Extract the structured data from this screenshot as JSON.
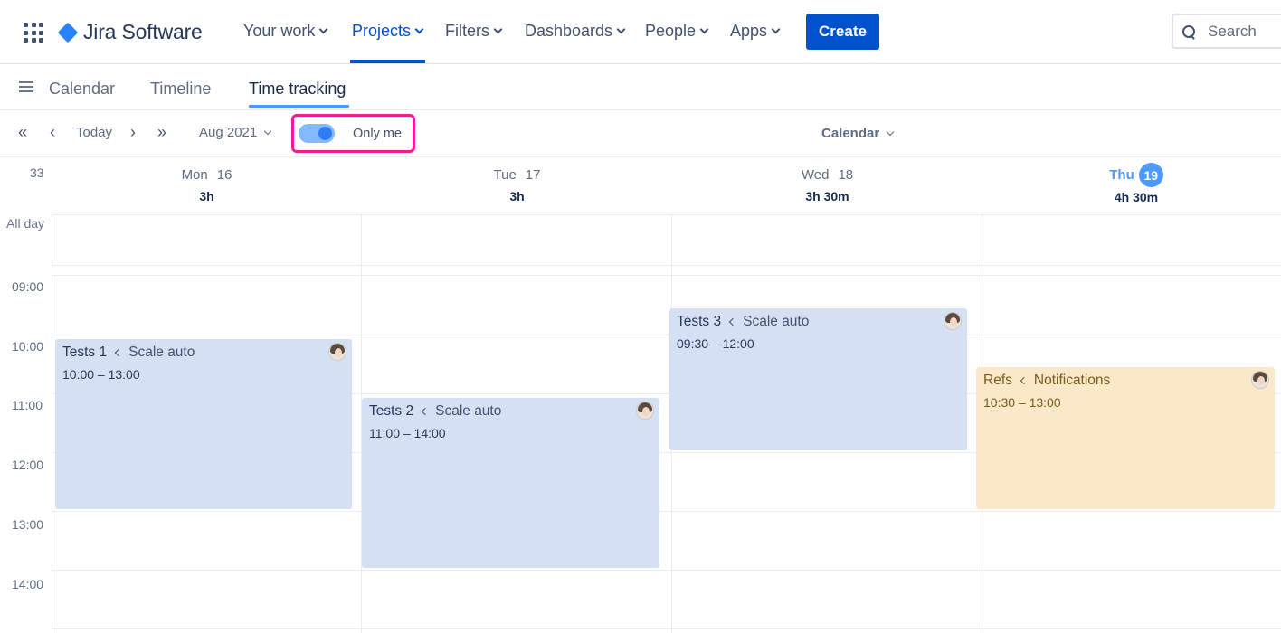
{
  "nav": {
    "logo_text": "Jira Software",
    "items": [
      {
        "label": "Your work"
      },
      {
        "label": "Projects"
      },
      {
        "label": "Filters"
      },
      {
        "label": "Dashboards"
      },
      {
        "label": "People"
      },
      {
        "label": "Apps"
      }
    ],
    "create_label": "Create",
    "search_placeholder": "Search"
  },
  "subtabs": [
    {
      "label": "Calendar"
    },
    {
      "label": "Timeline"
    },
    {
      "label": "Time tracking"
    }
  ],
  "toolbar": {
    "today_label": "Today",
    "month_label": "Aug 2021",
    "only_me_label": "Only me",
    "view_label": "Calendar"
  },
  "calendar": {
    "week_number": "33",
    "allday_label": "All day",
    "days": [
      {
        "name": "Mon",
        "num": "16",
        "total": "3h"
      },
      {
        "name": "Tue",
        "num": "17",
        "total": "3h"
      },
      {
        "name": "Wed",
        "num": "18",
        "total": "3h 30m"
      },
      {
        "name": "Thu",
        "num": "19",
        "total": "4h 30m"
      }
    ],
    "hours": [
      "09:00",
      "10:00",
      "11:00",
      "12:00",
      "13:00",
      "14:00"
    ],
    "events": [
      {
        "key": "Tests 1",
        "project": "Scale auto",
        "time": "10:00 – 13:00"
      },
      {
        "key": "Tests 2",
        "project": "Scale auto",
        "time": "11:00 – 14:00"
      },
      {
        "key": "Tests 3",
        "project": "Scale auto",
        "time": "09:30 – 12:00"
      },
      {
        "key": "Refs",
        "project": "Notifications",
        "time": "10:30 – 13:00"
      }
    ]
  },
  "colors": {
    "brand": "#0052cc",
    "event_blue": "#d6e0f5",
    "event_orange": "#fbe8c9",
    "highlight": "#ef1b9b",
    "today": "#4c9aff"
  }
}
